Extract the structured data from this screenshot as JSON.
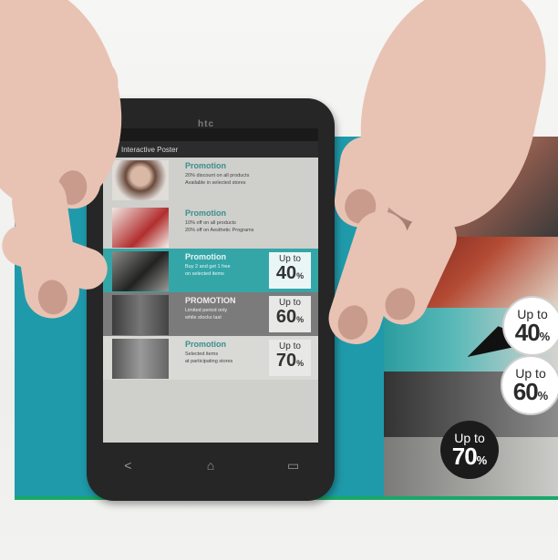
{
  "phone": {
    "brand": "htc",
    "app_title": "Interactive Poster",
    "nav": {
      "back": "<",
      "home": "⌂",
      "recent": "▭"
    }
  },
  "screen_promos": [
    {
      "title": "Promotion",
      "lines": [
        "20% discount on all products",
        "Available in selected stores"
      ],
      "style": "plain",
      "thumb": "face"
    },
    {
      "title": "Promotion",
      "lines": [
        "10% off on all products",
        "20% off on Aesthetic Programs"
      ],
      "style": "plain",
      "thumb": "kid"
    },
    {
      "title": "Promotion",
      "lines": [
        "Buy 2 and get 1 free",
        "on selected items"
      ],
      "style": "teal",
      "thumb": "shoe",
      "badge": {
        "up": "Up to",
        "num": "40",
        "pct": "%"
      }
    },
    {
      "title": "PROMOTION",
      "lines": [
        "Limited period only",
        "while stocks last"
      ],
      "style": "gray",
      "thumb": "legs",
      "badge": {
        "up": "Up to",
        "num": "60",
        "pct": "%"
      }
    },
    {
      "title": "Promotion",
      "lines": [
        "Selected items",
        "at participating stores"
      ],
      "style": "light",
      "thumb": "jeans",
      "badge": {
        "up": "Up to",
        "num": "70",
        "pct": "%"
      }
    }
  ],
  "poster_badges": [
    {
      "up": "Up to",
      "num": "40",
      "pct": "%",
      "variant": "light"
    },
    {
      "up": "Up to",
      "num": "60",
      "pct": "%",
      "variant": "light"
    },
    {
      "up": "Up to",
      "num": "70",
      "pct": "%",
      "variant": "dark"
    }
  ],
  "colors": {
    "poster_teal": "#1f9aaa",
    "screen_teal": "#34a6a8",
    "phone_body": "#262626"
  }
}
